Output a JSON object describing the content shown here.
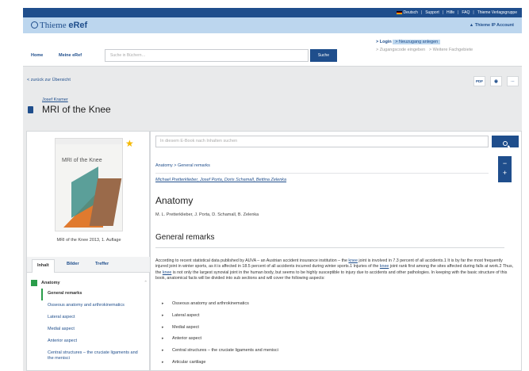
{
  "utilbar": {
    "items": [
      "Deutsch",
      "Support",
      "Hilfe",
      "FAQ",
      "Thieme Verlagsgruppe"
    ]
  },
  "header": {
    "logo_text": "Thieme",
    "logo_product": "eRef",
    "account": "Thieme IP Account"
  },
  "nav": {
    "home": "Home",
    "my_eref": "Meine eRef",
    "search_placeholder": "Suche in Büchern…",
    "search_button": "Suche",
    "login": "> Login",
    "register": "> Neuzugang anlegen",
    "access_code": "> Zugangscode eingeben",
    "more": "> Weitere Fachgebiete"
  },
  "page": {
    "back": "< zurück zur Übersicht",
    "tools": [
      "PDF",
      "🖶",
      "···"
    ],
    "author": "Josef Kramer",
    "book_title": "MRI of the Knee"
  },
  "sidebar": {
    "cover_title": "MRI of the Knee",
    "edition": "MRI of the Knee 2013, 1. Auflage",
    "tabs": [
      "Inhalt",
      "Bilder",
      "Treffer"
    ],
    "chapter": "Anatomy",
    "items": [
      "General remarks",
      "Osseous anatomy and arthrokinematics",
      "Lateral aspect",
      "Medial aspect",
      "Anterior aspect",
      "Central structures – the cruciate ligaments and the menisci"
    ]
  },
  "content": {
    "search_placeholder": "In diesem E-Book nach Inhalten suchen",
    "breadcrumb": "Anatomy > General remarks",
    "authors": "Michael Pretterklieber, Josef Porta, Doris Schamall, Bettina Zelenka",
    "title": "Anatomy",
    "byline": "M. L. Pretterklieber, J. Porta, D. Schamall, B. Zelenka",
    "section": "General remarks",
    "para1_a": "According to recent statistical data published by AUVA – an Austrian accident insurance institution – the ",
    "para1_link1": "knee",
    "para1_b": " joint is involved in 7.3 percent of all accidents.1 It is by far the most frequently injured joint in winter sports, as it is affected in 18.5 percent of all accidents incurred during winter sports.1 Injuries of the ",
    "para1_link2": "knee",
    "para1_c": " joint rank first among the sites affected during falls at work.2 Thus, the ",
    "para1_link3": "knee",
    "para1_d": " is not only the largest synovial joint in the human body, but seems to be highly susceptible to injury due to accidents and other pathologies. In keeping with the basic structure of this book, anatomical facts will be divided into sub sections and will cover the following aspects:",
    "bullets": [
      "Osseous anatomy and arthrokinematics",
      "Lateral aspect",
      "Medial aspect",
      "Anterior aspect",
      "Central structures – the cruciate ligaments and menisci",
      "Articular cartilage"
    ]
  }
}
